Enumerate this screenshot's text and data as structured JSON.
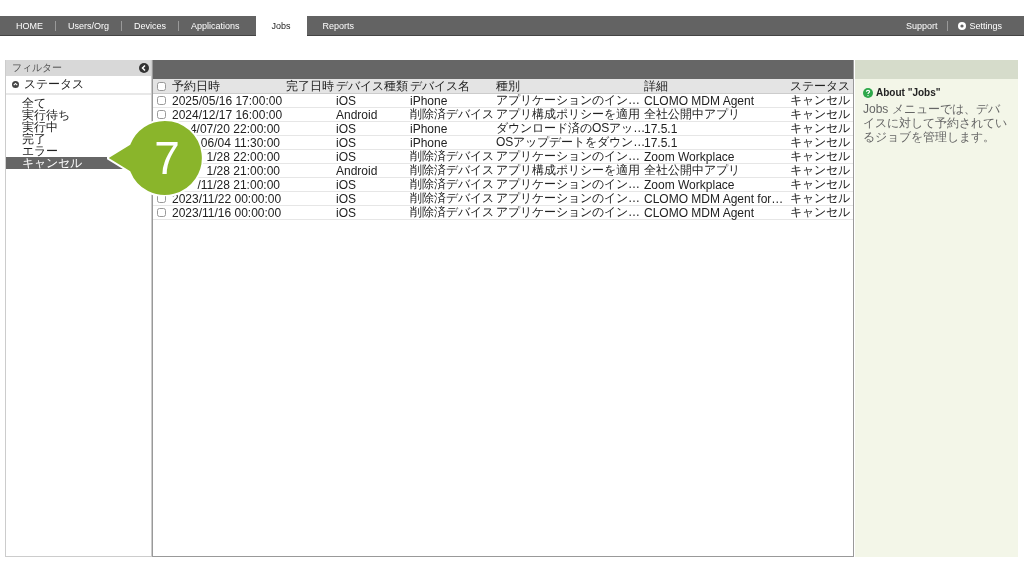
{
  "nav": {
    "tabs": [
      {
        "label": "HOME",
        "selected": false
      },
      {
        "label": "Users/Org",
        "selected": false
      },
      {
        "label": "Devices",
        "selected": false
      },
      {
        "label": "Applications",
        "selected": false
      },
      {
        "label": "Jobs",
        "selected": true
      },
      {
        "label": "Reports",
        "selected": false
      }
    ],
    "right": [
      {
        "label": "Support",
        "kind": "link"
      },
      {
        "label": "Settings",
        "kind": "settings"
      }
    ]
  },
  "filter": {
    "title": "フィルター",
    "section": "ステータス",
    "items": [
      {
        "label": "全て",
        "selected": false
      },
      {
        "label": "実行待ち",
        "selected": false
      },
      {
        "label": "実行中",
        "selected": false
      },
      {
        "label": "完了",
        "selected": false
      },
      {
        "label": "エラー",
        "selected": false
      },
      {
        "label": "キャンセル",
        "selected": true
      }
    ]
  },
  "table": {
    "columns": [
      "予約日時",
      "完了日時",
      "デバイス種類",
      "デバイス名",
      "種別",
      "詳細",
      "ステータス"
    ],
    "select_all": {
      "checked": false
    },
    "rows": [
      {
        "checked": false,
        "cells": [
          "2025/05/16 17:00:00",
          "",
          "iOS",
          "iPhone",
          "アプリケーションのイン…",
          "CLOMO MDM Agent",
          "キャンセル"
        ]
      },
      {
        "checked": false,
        "cells": [
          "2024/12/17 16:00:00",
          "",
          "Android",
          "削除済デバイス",
          "アプリ構成ポリシーを適用",
          "全社公開中アプリ",
          "キャンセル"
        ]
      },
      {
        "cells": [
          "4/07/20 22:00:00",
          "",
          "iOS",
          "iPhone",
          "ダウンロード済のOSアッ…",
          "17.5.1",
          "キャンセル"
        ]
      },
      {
        "cells": [
          "06/04 11:30:00",
          "",
          "iOS",
          "iPhone",
          "OSアップデートをダウン…",
          "17.5.1",
          "キャンセル"
        ]
      },
      {
        "cells": [
          "1/28 22:00:00",
          "",
          "iOS",
          "削除済デバイス",
          "アプリケーションのイン…",
          "Zoom Workplace",
          "キャンセル"
        ]
      },
      {
        "cells": [
          "1/28 21:00:00",
          "",
          "Android",
          "削除済デバイス",
          "アプリ構成ポリシーを適用",
          "全社公開中アプリ",
          "キャンセル"
        ]
      },
      {
        "cells": [
          "/11/28 21:00:00",
          "",
          "iOS",
          "削除済デバイス",
          "アプリケーションのイン…",
          "Zoom Workplace",
          "キャンセル"
        ]
      },
      {
        "checked": false,
        "cells": [
          "2023/11/22 00:00:00",
          "",
          "iOS",
          "削除済デバイス",
          "アプリケーションのイン…",
          "CLOMO MDM Agent for…",
          "キャンセル"
        ]
      },
      {
        "checked": false,
        "cells": [
          "2023/11/16 00:00:00",
          "",
          "iOS",
          "削除済デバイス",
          "アプリケーションのイン…",
          "CLOMO MDM Agent",
          "キャンセル"
        ]
      }
    ]
  },
  "help": {
    "title": "About \"Jobs\"",
    "text": "Jobs メニューでは、デバイスに対して予約されているジョブを管理します。"
  },
  "callout": {
    "number": "7"
  }
}
